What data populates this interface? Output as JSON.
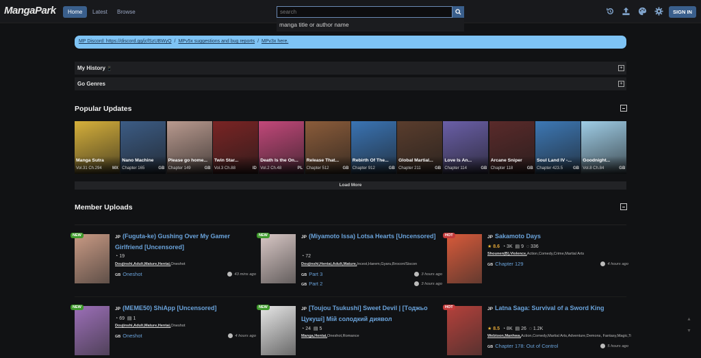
{
  "header": {
    "logo": "MangaPark",
    "nav": [
      "Home",
      "Latest",
      "Browse"
    ],
    "search_placeholder": "search",
    "search_hint": "manga title or author name",
    "signin": "SIGN IN",
    "tools": [
      "history-icon",
      "upload-icon",
      "palette-icon",
      "gear-icon"
    ]
  },
  "banner": {
    "discord": "MP Discord: https://discord.gg/jcfSzUBWyQ",
    "sep1": "/",
    "suggest": "MPv5x suggestions and bug reports",
    "sep2": "/",
    "here": "MPv3x here."
  },
  "panels": {
    "history": "My History",
    "history_emoji": "📱",
    "genres": "Go Genres"
  },
  "popular": {
    "title": "Popular Updates",
    "load_more": "Load More",
    "cards": [
      {
        "title": "Manga Sutra",
        "chapter": "Vol.31 Ch.294",
        "lang": "MX",
        "color": "#d6b03b"
      },
      {
        "title": "Nano Machine",
        "chapter": "Chapter 165",
        "lang": "GB",
        "color": "#3c5c85"
      },
      {
        "title": "Please go home...",
        "chapter": "Chapter 149",
        "lang": "GB",
        "color": "#b99a8f"
      },
      {
        "title": "Twin Star...",
        "chapter": "Vol.3 Ch.88",
        "lang": "ID",
        "color": "#7a2424"
      },
      {
        "title": "Death Is the On...",
        "chapter": "Vol.2 Ch.48",
        "lang": "PL",
        "color": "#c2487a"
      },
      {
        "title": "Release That...",
        "chapter": "Chapter 512",
        "lang": "GB",
        "color": "#8b5c3a"
      },
      {
        "title": "Rebirth Of The...",
        "chapter": "Chapter 912",
        "lang": "GB",
        "color": "#3a74b4"
      },
      {
        "title": "Global Martial...",
        "chapter": "Chapter 211",
        "lang": "GB",
        "color": "#5a3d2d"
      },
      {
        "title": "Love Is An...",
        "chapter": "Chapter 114",
        "lang": "GB",
        "color": "#6a5fa8"
      },
      {
        "title": "Arcane Sniper",
        "chapter": "Chapter 118",
        "lang": "GB",
        "color": "#5a2a2a"
      },
      {
        "title": "Soul Land IV -...",
        "chapter": "Chapter 423.5",
        "lang": "GB",
        "color": "#3d78b5"
      },
      {
        "title": "Goodnight...",
        "chapter": "Vol.8 Ch.84",
        "lang": "GB",
        "color": "#9fcde6"
      }
    ]
  },
  "uploads": {
    "title": "Member Uploads",
    "items": [
      {
        "badge": "NEW",
        "lang": "JP",
        "title": "(Fuguta-ke) Gushing Over My Gamer Girlfriend [Uncensored]",
        "stats": {
          "comments": "19"
        },
        "tags_bold": "Doujinshi,Adult,Mature,Hentai,",
        "tags": "Oneshot",
        "chapters": [
          {
            "lang": "GB",
            "name": "Oneshot",
            "time": "43 mins ago"
          }
        ],
        "color": "#c99a84"
      },
      {
        "badge": "NEW",
        "lang": "JP",
        "title": "(Miyamoto Issa) Lotsa Hearts [Uncensored]",
        "stats": {
          "comments": "72"
        },
        "tags_bold": "Doujinshi,Hentai,Adult,Mature,",
        "tags": "Incest,Harem,Gyaru,Brocon/Siscon",
        "chapters": [
          {
            "lang": "GB",
            "name": "Part 3",
            "time": "3 hours ago"
          },
          {
            "lang": "GB",
            "name": "Part 2",
            "time": "3 hours ago"
          }
        ],
        "color": "#d8c7c5"
      },
      {
        "badge": "HOT",
        "lang": "JP",
        "title": "Sakamoto Days",
        "stats": {
          "rating": "8.6",
          "comments": "3K",
          "reviews": "9",
          "replies": "336"
        },
        "tags_bold": "Shounen(B),Violence,",
        "tags": "Action,Comedy,Crime,Martial Arts",
        "chapters": [
          {
            "lang": "GB",
            "name": "Chapter 129",
            "time": "4 hours ago"
          }
        ],
        "color": "#d85a3a"
      },
      {
        "badge": "NEW",
        "lang": "JP",
        "title": "(MEME50) ShiApp [Uncensored]",
        "stats": {
          "comments": "69",
          "reviews": "1"
        },
        "tags_bold": "Doujinshi,Adult,Mature,Hentai,",
        "tags": "Oneshot",
        "chapters": [
          {
            "lang": "GB",
            "name": "Oneshot",
            "time": "4 hours ago"
          }
        ],
        "color": "#9c6fb8"
      },
      {
        "badge": "NEW",
        "lang": "JP",
        "title": "[Toujou Tsukushi] Sweet Devil | [Tоджьо Цукуші] Мій солодкий диявол",
        "stats": {
          "comments": "24",
          "reviews": "5"
        },
        "tags_bold": "Manga,Hentai,",
        "tags": "Oneshot,Romance",
        "chapters": [],
        "color": "#e6e6e6"
      },
      {
        "badge": "HOT",
        "lang": "JP",
        "title": "Latna Saga: Survival of a Sword King",
        "stats": {
          "rating": "8.5",
          "comments": "8K",
          "reviews": "26",
          "replies": "1.2K"
        },
        "tags_bold": "Webtoon,Manhwa,",
        "tags": "Action,Comedy,Martial Arts,Adventure,Demons, Fantasy,Magic,Tragedy,Isekai,Full Color,Mystery",
        "chapters": [
          {
            "lang": "GB",
            "name": "Chapter 178: Out of Control",
            "time": "5 hours ago"
          }
        ],
        "color": "#b5413b"
      }
    ]
  },
  "colors": {
    "accent": "#3a5f8c",
    "link": "#6aa3db",
    "banner": "#7ec3f4"
  }
}
